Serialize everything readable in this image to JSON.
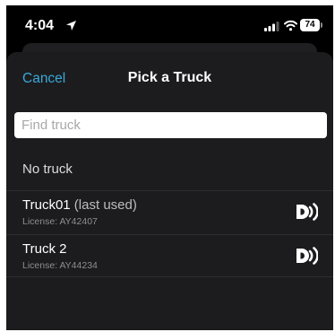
{
  "status_bar": {
    "time": "4:04",
    "battery_level": "74",
    "icons": [
      "location-arrow-icon",
      "signal-icon",
      "wifi-icon",
      "battery-icon"
    ]
  },
  "nav": {
    "cancel_label": "Cancel",
    "title": "Pick a Truck"
  },
  "search": {
    "placeholder": "Find truck",
    "value": ""
  },
  "no_truck_label": "No truck",
  "trucks": [
    {
      "name": "Truck01",
      "suffix": " (last used)",
      "license_prefix": "License: ",
      "license": "AY42407",
      "icon": "rfid-signal-icon"
    },
    {
      "name": "Truck 2",
      "suffix": "",
      "license_prefix": "License: ",
      "license": "AY44234",
      "icon": "rfid-signal-icon"
    }
  ],
  "colors": {
    "background": "#000000",
    "sheet": "#1c1c1e",
    "accent": "#3aa8d8",
    "divider": "#2e2e31"
  }
}
